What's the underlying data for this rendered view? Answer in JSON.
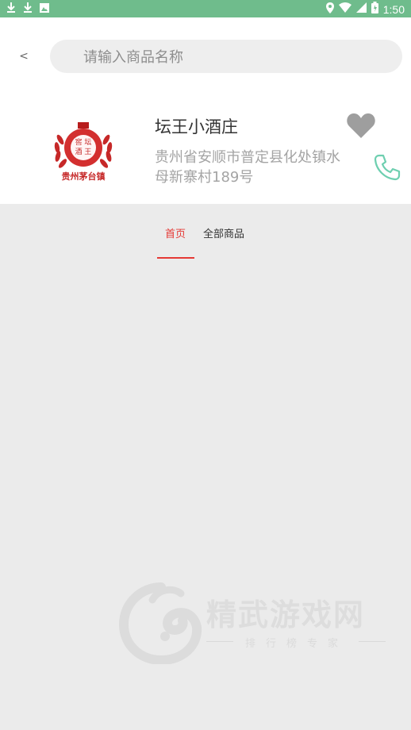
{
  "status_bar": {
    "time": "1:50",
    "left_icons": [
      "download-icon",
      "download-icon",
      "image-icon"
    ],
    "right_icons": [
      "location-icon",
      "wifi-icon",
      "signal-icon",
      "battery-icon"
    ]
  },
  "header": {
    "back_label": "<",
    "search_placeholder": "请输入商品名称"
  },
  "shop": {
    "name": "坛王小酒庄",
    "address": "贵州省安顺市普定县化处镇水母新寨村189号",
    "logo": {
      "caption": "贵州茅台镇",
      "inner_text": [
        "窖",
        "坛",
        "酒",
        "王"
      ]
    }
  },
  "tabs": [
    {
      "label": "首页",
      "active": true
    },
    {
      "label": "全部商品",
      "active": false
    }
  ],
  "watermark": {
    "title": "精武游戏网",
    "subtitle": "排行榜专家"
  },
  "colors": {
    "status_bar": "#6fbc8c",
    "accent_red": "#e53935",
    "phone_green": "#6ecfb0",
    "heart_gray": "#9e9e9e"
  }
}
